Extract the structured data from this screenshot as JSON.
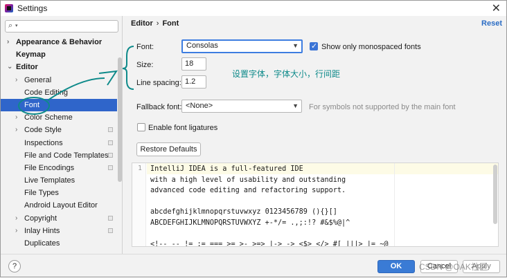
{
  "window": {
    "title": "Settings",
    "close_label": "✕"
  },
  "sidebar": {
    "search_placeholder": "",
    "items": [
      {
        "label": "Appearance & Behavior",
        "indent": 0,
        "arrow": "›",
        "bold": true,
        "selected": false,
        "cfg": false
      },
      {
        "label": "Keymap",
        "indent": 0,
        "arrow": "",
        "bold": true,
        "selected": false,
        "cfg": false
      },
      {
        "label": "Editor",
        "indent": 0,
        "arrow": "⌄",
        "bold": true,
        "selected": false,
        "cfg": false
      },
      {
        "label": "General",
        "indent": 1,
        "arrow": "›",
        "bold": false,
        "selected": false,
        "cfg": false
      },
      {
        "label": "Code Editing",
        "indent": 1,
        "arrow": "",
        "bold": false,
        "selected": false,
        "cfg": false
      },
      {
        "label": "Font",
        "indent": 1,
        "arrow": "",
        "bold": false,
        "selected": true,
        "cfg": false
      },
      {
        "label": "Color Scheme",
        "indent": 1,
        "arrow": "›",
        "bold": false,
        "selected": false,
        "cfg": false
      },
      {
        "label": "Code Style",
        "indent": 1,
        "arrow": "›",
        "bold": false,
        "selected": false,
        "cfg": true
      },
      {
        "label": "Inspections",
        "indent": 1,
        "arrow": "",
        "bold": false,
        "selected": false,
        "cfg": true
      },
      {
        "label": "File and Code Templates",
        "indent": 1,
        "arrow": "",
        "bold": false,
        "selected": false,
        "cfg": true
      },
      {
        "label": "File Encodings",
        "indent": 1,
        "arrow": "",
        "bold": false,
        "selected": false,
        "cfg": true
      },
      {
        "label": "Live Templates",
        "indent": 1,
        "arrow": "",
        "bold": false,
        "selected": false,
        "cfg": false
      },
      {
        "label": "File Types",
        "indent": 1,
        "arrow": "",
        "bold": false,
        "selected": false,
        "cfg": false
      },
      {
        "label": "Android Layout Editor",
        "indent": 1,
        "arrow": "",
        "bold": false,
        "selected": false,
        "cfg": false
      },
      {
        "label": "Copyright",
        "indent": 1,
        "arrow": "›",
        "bold": false,
        "selected": false,
        "cfg": true
      },
      {
        "label": "Inlay Hints",
        "indent": 1,
        "arrow": "›",
        "bold": false,
        "selected": false,
        "cfg": true
      },
      {
        "label": "Duplicates",
        "indent": 1,
        "arrow": "",
        "bold": false,
        "selected": false,
        "cfg": false
      }
    ]
  },
  "main": {
    "breadcrumb": {
      "parent": "Editor",
      "separator": "›",
      "current": "Font"
    },
    "reset_label": "Reset",
    "font_label": "Font:",
    "font_value": "Consolas",
    "monospace_label": "Show only monospaced fonts",
    "monospace_checked": true,
    "size_label": "Size:",
    "size_value": "18",
    "line_spacing_label": "Line spacing:",
    "line_spacing_value": "1.2",
    "annotation": "设置字体，字体大小，行间距",
    "fallback_label": "Fallback font:",
    "fallback_value": "<None>",
    "fallback_hint": "For symbols not supported by the main font",
    "ligatures_label": "Enable font ligatures",
    "ligatures_checked": false,
    "restore_label": "Restore Defaults"
  },
  "preview": {
    "line_number": "1",
    "lines": [
      "IntelliJ IDEA is a full-featured IDE",
      "with a high level of usability and outstanding",
      "advanced code editing and refactoring support.",
      "",
      "abcdefghijklmnopqrstuvwxyz 0123456789 (){}[]",
      "ABCDEFGHIJKLMNOPQRSTUVWXYZ +-*/= .,;:!? #&$%@|^",
      "",
      "<!-- -- != := === >= >- >=> |-> -> <$> </> #[ |||> |= ~@"
    ]
  },
  "footer": {
    "help_label": "?",
    "ok_label": "OK",
    "cancel_label": "Cancel",
    "apply_label": "Apply"
  },
  "watermark": "CSDN @OAK社区",
  "colors": {
    "selection": "#2f65ca",
    "annotation": "#0e8a8a",
    "link": "#2a6cc4",
    "ok_button": "#3a7bd5"
  }
}
